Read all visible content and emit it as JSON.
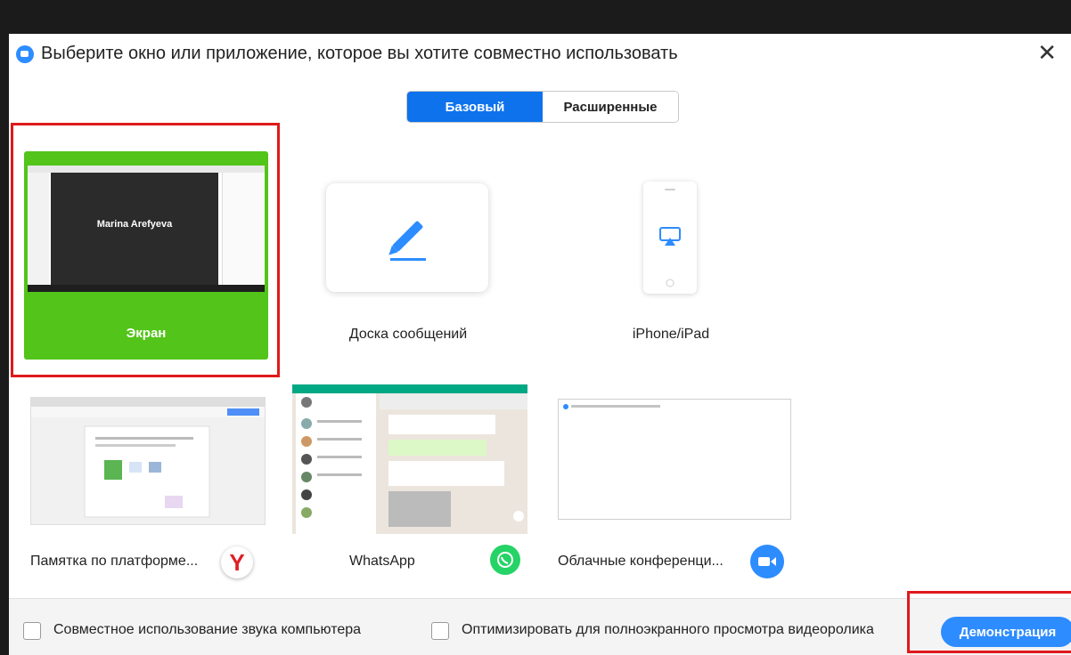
{
  "window": {
    "title": "Выберите окно или приложение, которое вы хотите совместно использовать"
  },
  "tabs": [
    {
      "label": "Базовый",
      "active": true
    },
    {
      "label": "Расширенные",
      "active": false
    }
  ],
  "tiles": {
    "screen": {
      "label": "Экран",
      "thumbnail_name": "Marina Arefyeva",
      "selected": true
    },
    "whiteboard": {
      "label": "Доска сообщений",
      "icon": "pencil-icon"
    },
    "iphone": {
      "label": "iPhone/iPad",
      "icon": "airplay-icon"
    }
  },
  "windows": [
    {
      "label": "Памятка по платформе...",
      "icon": "yandex-browser-icon"
    },
    {
      "label": "WhatsApp",
      "icon": "whatsapp-icon"
    },
    {
      "label": "Облачные конференци...",
      "icon": "zoom-icon"
    }
  ],
  "footer": {
    "share_audio": "Совместное использование звука компьютера",
    "optimize_video": "Оптимизировать для полноэкранного просмотра видеоролика",
    "share_button": "Демонстрация"
  },
  "colors": {
    "accent": "#0e72ed",
    "selected_tile": "#52c41a",
    "highlight": "#e0191b",
    "zoom": "#2d8cff"
  }
}
